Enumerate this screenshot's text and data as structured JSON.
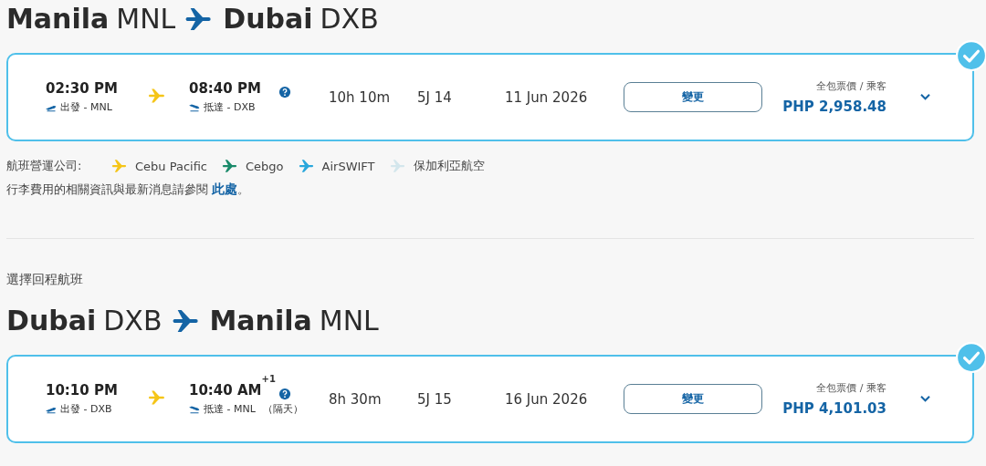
{
  "outbound": {
    "heading": {
      "from_city": "Manila",
      "from_code": "MNL",
      "to_city": "Dubai",
      "to_code": "DXB"
    },
    "flight": {
      "selected": true,
      "depart_time": "02:30 PM",
      "depart_label": "出發 - MNL",
      "arrive_time": "08:40 PM",
      "arrive_label": "抵達 - DXB",
      "duration": "10h 10m",
      "flight_no": "5J 14",
      "date": "11 Jun 2026",
      "change_button": "變更",
      "price_label": "全包票價 / 乘客",
      "price": "PHP 2,958.48"
    },
    "operators_label": "航班營運公司:",
    "operators": [
      {
        "name": "Cebu Pacific",
        "color": "#f5c518"
      },
      {
        "name": "Cebgo",
        "color": "#1a8a6a"
      },
      {
        "name": "AirSWIFT",
        "color": "#2aa7dc"
      },
      {
        "name": "保加利亞航空",
        "color": "#d3e6ec"
      }
    ],
    "baggage_note": {
      "text": "行李費用的相關資訊與最新消息請參閱",
      "link": "此處",
      "end": "。"
    }
  },
  "return": {
    "section_label": "選擇回程航班",
    "heading": {
      "from_city": "Dubai",
      "from_code": "DXB",
      "to_city": "Manila",
      "to_code": "MNL"
    },
    "flight": {
      "selected": true,
      "depart_time": "10:10 PM",
      "depart_label": "出發 - DXB",
      "arrive_time": "10:40 AM",
      "day_offset": "+1",
      "arrive_label": "抵達 - MNL",
      "next_day": "（隔天）",
      "duration": "8h 30m",
      "flight_no": "5J 15",
      "date": "16 Jun 2026",
      "change_button": "變更",
      "price_label": "全包票價 / 乘客",
      "price": "PHP 4,101.03"
    }
  }
}
